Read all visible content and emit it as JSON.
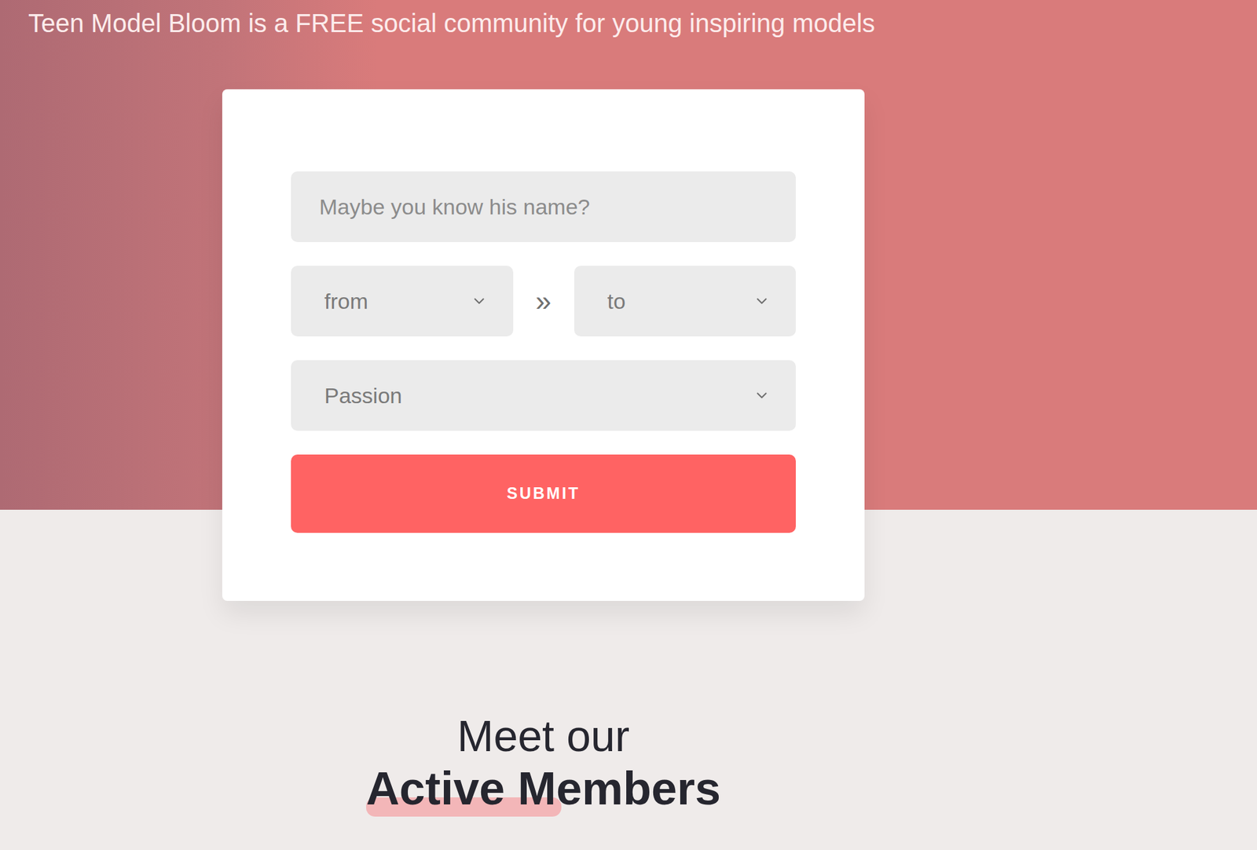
{
  "hero": {
    "title": "Teen Model Bloom is a FREE social community for young inspiring models"
  },
  "search_form": {
    "name_placeholder": "Maybe you know his name?",
    "from": {
      "label": "from"
    },
    "separator": "»",
    "to": {
      "label": "to"
    },
    "passion": {
      "label": "Passion"
    },
    "submit": "SUBMIT"
  },
  "members_section": {
    "line1": "Meet our",
    "line2": "Active Members"
  }
}
